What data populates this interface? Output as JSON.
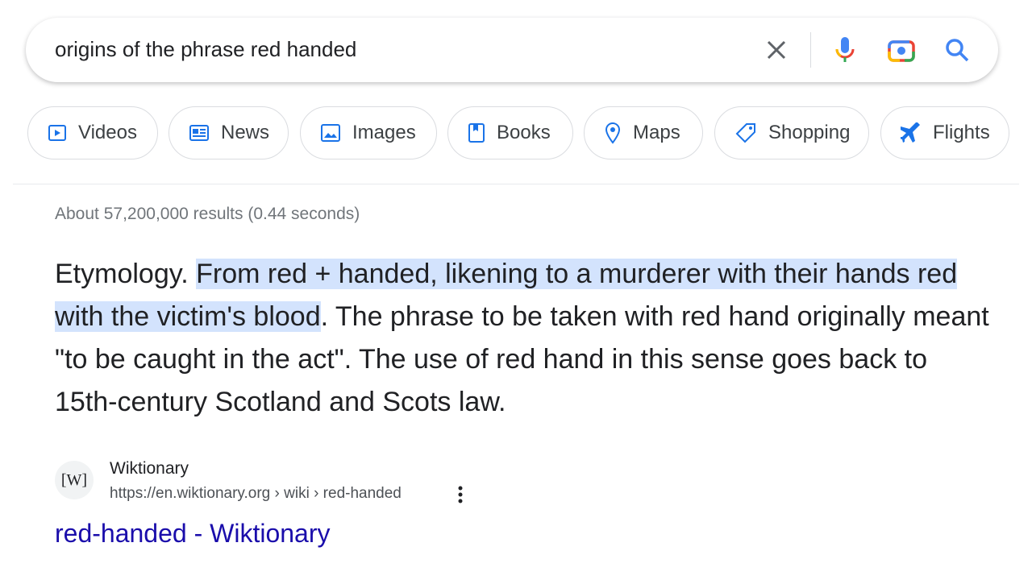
{
  "search": {
    "query": "origins of the phrase red handed",
    "icons": [
      "close-icon",
      "microphone-icon",
      "camera-lens-icon",
      "search-icon"
    ]
  },
  "chips": [
    {
      "label": "Videos",
      "icon": "video-play-icon"
    },
    {
      "label": "News",
      "icon": "newspaper-icon"
    },
    {
      "label": "Images",
      "icon": "image-icon"
    },
    {
      "label": "Books",
      "icon": "book-icon"
    },
    {
      "label": "Maps",
      "icon": "map-pin-icon"
    },
    {
      "label": "Shopping",
      "icon": "tag-icon"
    },
    {
      "label": "Flights",
      "icon": "airplane-icon"
    }
  ],
  "stats": "About 57,200,000 results (0.44 seconds)",
  "snippet": {
    "before": "Etymology. ",
    "highlight": "From red + handed, likening to a murderer with their hands red with the victim's blood",
    "after": ". The phrase to be taken with red hand originally meant \"to be caught in the act\". The use of red hand in this sense goes back to 15th-century Scotland and Scots law."
  },
  "result": {
    "favicon": "[W]",
    "site": "Wiktionary",
    "url": "https://en.wiktionary.org › wiki › red-handed",
    "title": "red-handed - Wiktionary"
  },
  "colors": {
    "link": "#1a0dab",
    "highlight": "#d3e3fd",
    "chip_icon": "#1a73e8"
  }
}
